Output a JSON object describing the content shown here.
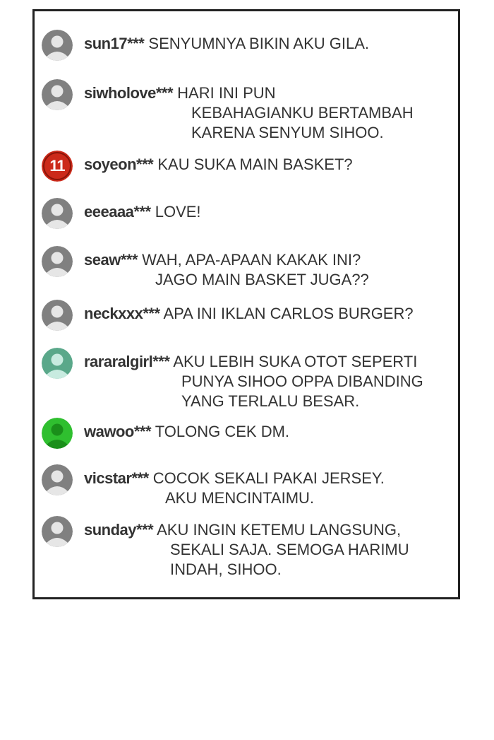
{
  "comments": [
    {
      "user": "sun17***",
      "lines": [
        "SENYUMNYA BIKIN AKU GILA."
      ],
      "avatar_color": "#808080",
      "badge": null
    },
    {
      "user": "siwholove***",
      "lines": [
        "HARI INI PUN",
        "KEBAHAGIANKU BERTAMBAH",
        "KARENA SENYUM SIHOO."
      ],
      "avatar_color": "#808080",
      "badge": null
    },
    {
      "user": "soyeon***",
      "lines": [
        "KAU SUKA MAIN BASKET?"
      ],
      "avatar_color": "#cc2a1a",
      "badge": "11"
    },
    {
      "user": "eeeaaa***",
      "lines": [
        "LOVE!"
      ],
      "avatar_color": "#808080",
      "badge": null
    },
    {
      "user": "seaw***",
      "lines": [
        "WAH, APA-APAAN KAKAK INI?",
        "JAGO MAIN BASKET JUGA??"
      ],
      "avatar_color": "#808080",
      "badge": null
    },
    {
      "user": "neckxxx***",
      "lines": [
        "APA INI IKLAN CARLOS BURGER?"
      ],
      "avatar_color": "#808080",
      "badge": null
    },
    {
      "user": "rararalgirl***",
      "lines": [
        "AKU LEBIH SUKA OTOT SEPERTI",
        "PUNYA SIHOO OPPA DIBANDING",
        "YANG TERLALU BESAR."
      ],
      "avatar_color": "#5aa88a",
      "badge": null
    },
    {
      "user": "wawoo***",
      "lines": [
        "TOLONG CEK DM."
      ],
      "avatar_color": "#2fbf2f",
      "badge": null
    },
    {
      "user": "vicstar***",
      "lines": [
        "COCOK SEKALI PAKAI JERSEY.",
        "AKU MENCINTAIMU."
      ],
      "avatar_color": "#808080",
      "badge": null
    },
    {
      "user": "sunday***",
      "lines": [
        "AKU INGIN KETEMU LANGSUNG,",
        "SEKALI SAJA. SEMOGA HARIMU",
        "INDAH, SIHOO."
      ],
      "avatar_color": "#808080",
      "badge": null
    }
  ]
}
